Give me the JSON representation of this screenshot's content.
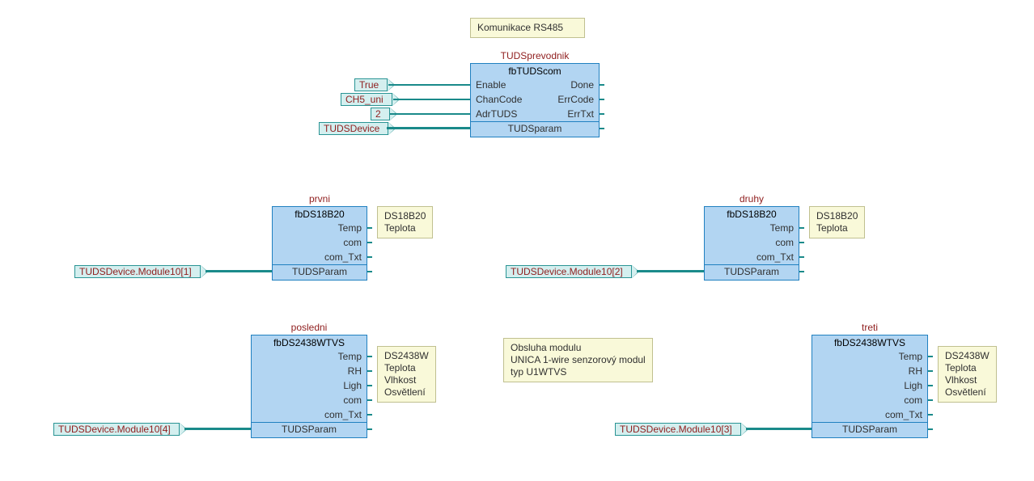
{
  "notes": {
    "top": "Komunikace RS485",
    "prvni": "DS18B20\nTeplota",
    "druhy": "DS18B20\nTeplota",
    "posledni": "DS2438W\nTeplota\nVlhkost\nOsvětlení",
    "treti": "DS2438W\nTeplota\nVlhkost\nOsvětlení",
    "modul": "Obsluha modulu\nUNICA 1-wire senzorový modul\ntyp U1WTVS"
  },
  "blocks": {
    "main": {
      "instance": "TUDSprevodnik",
      "type": "fbTUDScom",
      "left": [
        "Enable",
        "ChanCode",
        "AdrTUDS"
      ],
      "right": [
        "Done",
        "ErrCode",
        "ErrTxt"
      ],
      "bus": "TUDSparam"
    },
    "prvni": {
      "instance": "prvni",
      "type": "fbDS18B20",
      "right": [
        "Temp",
        "com",
        "com_Txt"
      ],
      "bus": "TUDSParam"
    },
    "druhy": {
      "instance": "druhy",
      "type": "fbDS18B20",
      "right": [
        "Temp",
        "com",
        "com_Txt"
      ],
      "bus": "TUDSParam"
    },
    "posledni": {
      "instance": "posledni",
      "type": "fbDS2438WTVS",
      "right": [
        "Temp",
        "RH",
        "Ligh",
        "com",
        "com_Txt"
      ],
      "bus": "TUDSParam"
    },
    "treti": {
      "instance": "treti",
      "type": "fbDS2438WTVS",
      "right": [
        "Temp",
        "RH",
        "Ligh",
        "com",
        "com_Txt"
      ],
      "bus": "TUDSParam"
    }
  },
  "tags": {
    "true": "True",
    "ch5": "CH5_uni",
    "two": "2",
    "dev": "TUDSDevice",
    "mod1": "TUDSDevice.Module10[1]",
    "mod2": "TUDSDevice.Module10[2]",
    "mod3": "TUDSDevice.Module10[3]",
    "mod4": "TUDSDevice.Module10[4]"
  }
}
